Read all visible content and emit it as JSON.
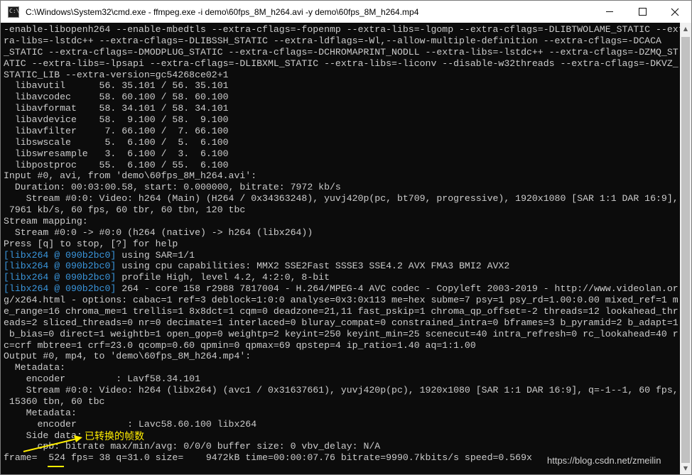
{
  "window": {
    "title": "C:\\Windows\\System32\\cmd.exe - ffmpeg.exe  -i demo\\60fps_8M_h264.avi -y demo\\60fps_8M_h264.mp4",
    "icon_text": "C:\\",
    "controls": [
      "minimize-icon",
      "maximize-icon",
      "close-icon"
    ]
  },
  "console": {
    "colors": {
      "text": "#cccccc",
      "tag": "#3a96dd",
      "background": "#0c0c0c"
    },
    "lines": [
      {
        "text": "-enable-libopenh264 --enable-mbedtls --extra-cflags=-fopenmp --extra-libs=-lgomp --extra-cflags=-DLIBTWOLAME_STATIC --ext"
      },
      {
        "text": "ra-libs=-lstdc++ --extra-cflags=-DLIBSSH_STATIC --extra-ldflags=-Wl,--allow-multiple-definition --extra-cflags=-DCACA"
      },
      {
        "text": "_STATIC --extra-cflags=-DMODPLUG_STATIC --extra-cflags=-DCHROMAPRINT_NODLL --extra-libs=-lstdc++ --extra-cflags=-DZMQ_ST"
      },
      {
        "text": "ATIC --extra-libs=-lpsapi --extra-cflags=-DLIBXML_STATIC --extra-libs=-liconv --disable-w32threads --extra-cflags=-DKVZ_"
      },
      {
        "text": "STATIC_LIB --extra-version=gc54268ce02+1"
      },
      {
        "text": "  libavutil      56. 35.101 / 56. 35.101"
      },
      {
        "text": "  libavcodec     58. 60.100 / 58. 60.100"
      },
      {
        "text": "  libavformat    58. 34.101 / 58. 34.101"
      },
      {
        "text": "  libavdevice    58.  9.100 / 58.  9.100"
      },
      {
        "text": "  libavfilter     7. 66.100 /  7. 66.100"
      },
      {
        "text": "  libswscale      5.  6.100 /  5.  6.100"
      },
      {
        "text": "  libswresample   3.  6.100 /  3.  6.100"
      },
      {
        "text": "  libpostproc    55.  6.100 / 55.  6.100"
      },
      {
        "text": "Input #0, avi, from 'demo\\60fps_8M_h264.avi':"
      },
      {
        "text": "  Duration: 00:03:00.58, start: 0.000000, bitrate: 7972 kb/s"
      },
      {
        "text": "    Stream #0:0: Video: h264 (Main) (H264 / 0x34363248), yuvj420p(pc, bt709, progressive), 1920x1080 [SAR 1:1 DAR 16:9],"
      },
      {
        "text": " 7961 kb/s, 60 fps, 60 tbr, 60 tbn, 120 tbc"
      },
      {
        "text": "Stream mapping:"
      },
      {
        "text": "  Stream #0:0 -> #0:0 (h264 (native) -> h264 (libx264))"
      },
      {
        "text": "Press [q] to stop, [?] for help"
      },
      {
        "tag": "[libx264 @ 090b2bc0]",
        "text": " using SAR=1/1"
      },
      {
        "tag": "[libx264 @ 090b2bc0]",
        "text": " using cpu capabilities: MMX2 SSE2Fast SSSE3 SSE4.2 AVX FMA3 BMI2 AVX2"
      },
      {
        "tag": "[libx264 @ 090b2bc0]",
        "text": " profile High, level 4.2, 4:2:0, 8-bit"
      },
      {
        "tag": "[libx264 @ 090b2bc0]",
        "text": " 264 - core 158 r2988 7817004 - H.264/MPEG-4 AVC codec - Copyleft 2003-2019 - http://www.videolan.or"
      },
      {
        "text": "g/x264.html - options: cabac=1 ref=3 deblock=1:0:0 analyse=0x3:0x113 me=hex subme=7 psy=1 psy_rd=1.00:0.00 mixed_ref=1 m"
      },
      {
        "text": "e_range=16 chroma_me=1 trellis=1 8x8dct=1 cqm=0 deadzone=21,11 fast_pskip=1 chroma_qp_offset=-2 threads=12 lookahead_thr"
      },
      {
        "text": "eads=2 sliced_threads=0 nr=0 decimate=1 interlaced=0 bluray_compat=0 constrained_intra=0 bframes=3 b_pyramid=2 b_adapt=1"
      },
      {
        "text": " b_bias=0 direct=1 weightb=1 open_gop=0 weightp=2 keyint=250 keyint_min=25 scenecut=40 intra_refresh=0 rc_lookahead=40 r"
      },
      {
        "text": "c=crf mbtree=1 crf=23.0 qcomp=0.60 qpmin=0 qpmax=69 qpstep=4 ip_ratio=1.40 aq=1:1.00"
      },
      {
        "text": "Output #0, mp4, to 'demo\\60fps_8M_h264.mp4':"
      },
      {
        "text": "  Metadata:"
      },
      {
        "text": "    encoder         : Lavf58.34.101"
      },
      {
        "text": "    Stream #0:0: Video: h264 (libx264) (avc1 / 0x31637661), yuvj420p(pc), 1920x1080 [SAR 1:1 DAR 16:9], q=-1--1, 60 fps,"
      },
      {
        "text": " 15360 tbn, 60 tbc"
      },
      {
        "text": "    Metadata:"
      },
      {
        "text": "      encoder         : Lavc58.60.100 libx264"
      },
      {
        "text": "    Side data:"
      },
      {
        "text": "      cpb: bitrate max/min/avg: 0/0/0 buffer size: 0 vbv_delay: N/A"
      },
      {
        "text": "frame=  524 fps= 38 q=31.0 size=    9472kB time=00:00:07.76 bitrate=9990.7kbits/s speed=0.569x"
      }
    ]
  },
  "annotation": {
    "label": "已转换的帧数",
    "color": "#ffee00"
  },
  "watermark": "https://blog.csdn.net/zmeilin"
}
